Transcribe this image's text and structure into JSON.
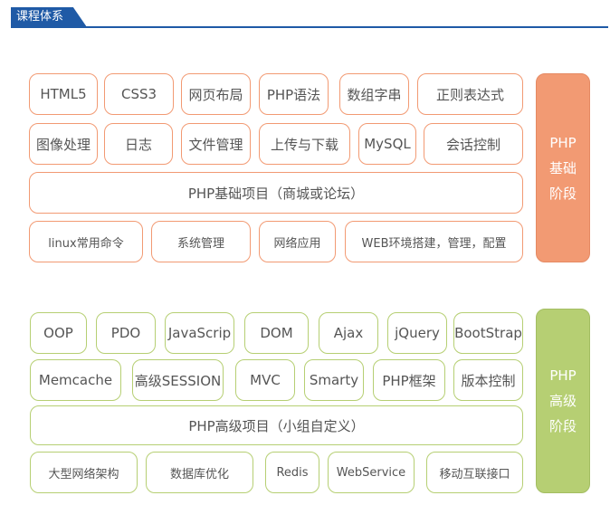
{
  "header": {
    "title": "课程体系"
  },
  "basic": {
    "stage": [
      "PHP",
      "基础",
      "阶段"
    ],
    "row1": [
      "HTML5",
      "CSS3",
      "网页布局",
      "PHP语法",
      "数组字串",
      "正则表达式"
    ],
    "row2": [
      "图像处理",
      "日志",
      "文件管理",
      "上传与下载",
      "MySQL",
      "会话控制"
    ],
    "project": "PHP基础项目（商城或论坛）",
    "row4": [
      "linux常用命令",
      "系统管理",
      "网络应用",
      "WEB环境搭建，管理，配置"
    ]
  },
  "advanced": {
    "stage": [
      "PHP",
      "高级",
      "阶段"
    ],
    "row1": [
      "OOP",
      "PDO",
      "JavaScrip",
      "DOM",
      "Ajax",
      "jQuery",
      "BootStrap"
    ],
    "row2": [
      "Memcache",
      "高级SESSION",
      "MVC",
      "Smarty",
      "PHP框架",
      "版本控制"
    ],
    "project": "PHP高级项目（小组自定义）",
    "row4": [
      "大型网络架构",
      "数据库优化",
      "Redis",
      "WebService",
      "移动互联接口"
    ]
  },
  "colors": {
    "header": "#1f5aa6",
    "basic": "#f29a73",
    "advanced": "#b6cf73"
  }
}
